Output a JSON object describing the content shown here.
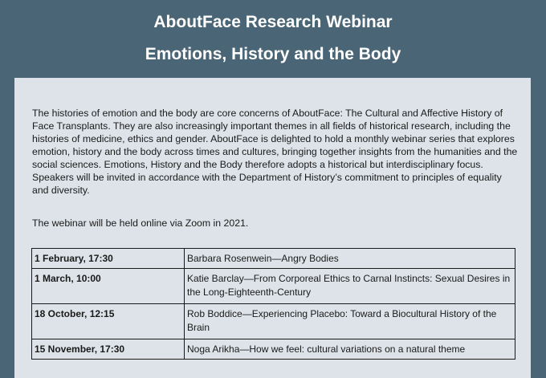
{
  "header": {
    "title_line1": "AboutFace Research Webinar",
    "title_line2": "Emotions, History and the Body"
  },
  "intro": "The histories of emotion and the body are core concerns of AboutFace: The Cultural and Affective History of Face Transplants. They are also increasingly important themes in all fields of historical research, including the histories of medicine, ethics and gender. AboutFace is delighted to hold a monthly webinar series that explores emotion, history and the body across times and cultures, bringing together insights from the humanities and the social sciences. Emotions, History and the Body therefore adopts a historical but interdisciplinary focus. Speakers will be invited in accordance with the Department of History’s commitment to principles of equality and diversity.",
  "note": "The webinar will be held online via Zoom in 2021.",
  "schedule": [
    {
      "date": "1 February, 17:30",
      "talk": "Barbara Rosenwein—Angry Bodies"
    },
    {
      "date": "1 March, 10:00",
      "talk": "Katie Barclay—From Corporeal Ethics to Carnal Instincts: Sexual Desires in the Long-Eighteenth-Century"
    },
    {
      "date": "18 October, 12:15",
      "talk": "Rob Boddice—Experiencing Placebo: Toward a Biocultural History of the Brain"
    },
    {
      "date": "15 November, 17:30",
      "talk": "Noga Arikha—How we feel: cultural variations on a natural theme"
    }
  ]
}
